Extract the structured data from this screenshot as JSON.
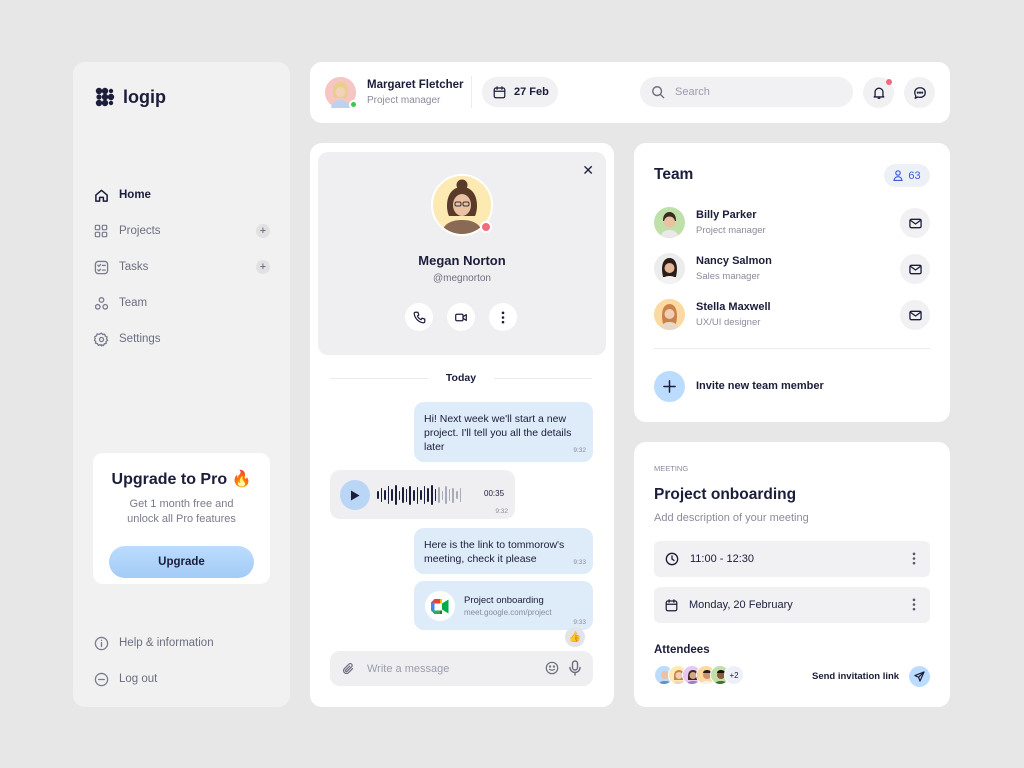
{
  "app": {
    "logo_text": "logip"
  },
  "sidebar": {
    "items": [
      {
        "label": "Home",
        "icon": "home-icon",
        "active": true
      },
      {
        "label": "Projects",
        "icon": "grid-icon",
        "plus": true
      },
      {
        "label": "Tasks",
        "icon": "checklist-icon",
        "plus": true
      },
      {
        "label": "Team",
        "icon": "team-icon"
      },
      {
        "label": "Settings",
        "icon": "gear-icon"
      }
    ],
    "upgrade": {
      "title": "Upgrade to Pro 🔥",
      "description": "Get 1 month free and unlock all Pro features",
      "button": "Upgrade"
    },
    "bottom_items": [
      {
        "label": "Help & information",
        "icon": "info-icon"
      },
      {
        "label": "Log out",
        "icon": "logout-icon"
      }
    ]
  },
  "header": {
    "user_name": "Margaret Fletcher",
    "user_role": "Project manager",
    "date": "27 Feb",
    "search_placeholder": "Search"
  },
  "chat": {
    "contact": {
      "name": "Megan Norton",
      "handle": "@megnorton"
    },
    "day_divider": "Today",
    "messages": [
      {
        "text": "Hi! Next week we'll start a new project. I'll tell you all the details later",
        "time": "9:32"
      },
      {
        "type": "voice",
        "duration": "00:35",
        "time": "9:32"
      },
      {
        "text": "Here is the link to tommorow's meeting, check it please",
        "time": "9:33"
      },
      {
        "type": "link",
        "title": "Project onboarding",
        "url": "meet.google.com/project",
        "time": "9:33",
        "reaction": "👍"
      }
    ],
    "composer_placeholder": "Write a message"
  },
  "team": {
    "title": "Team",
    "count": "63",
    "members": [
      {
        "name": "Billy Parker",
        "role": "Project manager"
      },
      {
        "name": "Nancy Salmon",
        "role": "Sales manager"
      },
      {
        "name": "Stella Maxwell",
        "role": "UX/UI designer"
      }
    ],
    "invite_label": "Invite new team member"
  },
  "meeting": {
    "label": "MEETING",
    "title": "Project onboarding",
    "description": "Add description of your meeting",
    "time": "11:00 - 12:30",
    "date": "Monday, 20 February",
    "attendees_label": "Attendees",
    "attendees_more": "+2",
    "send_label": "Send invitation link"
  },
  "colors": {
    "accent": "#bcdcff",
    "bubble": "#deebf9",
    "online": "#3ec64c",
    "alert": "#f06b7c"
  }
}
